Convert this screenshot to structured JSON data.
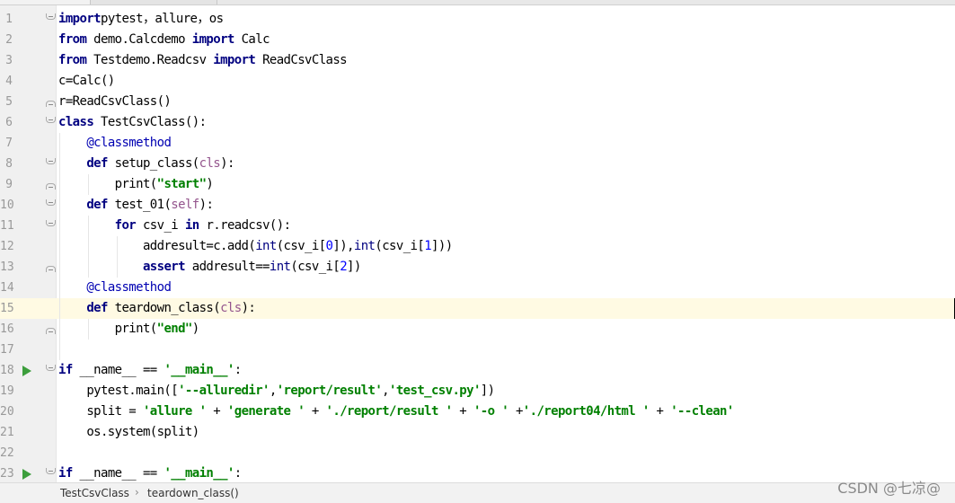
{
  "editor": {
    "current_line": 15,
    "lines": [
      {
        "n": "1",
        "tokens": [
          [
            "kw",
            "import"
          ],
          [
            "",
            "pytest"
          ],
          [
            "",
            "，"
          ],
          [
            "",
            "allure"
          ],
          [
            "",
            "，"
          ],
          [
            "",
            "os"
          ]
        ]
      },
      {
        "n": "2",
        "tokens": [
          [
            "kw",
            "from"
          ],
          [
            "",
            " demo.Calcdemo "
          ],
          [
            "kw",
            "import"
          ],
          [
            "",
            " Calc"
          ]
        ]
      },
      {
        "n": "3",
        "tokens": [
          [
            "kw",
            "from"
          ],
          [
            "",
            " Testdemo.Readcsv "
          ],
          [
            "kw",
            "import"
          ],
          [
            "",
            " ReadCsvClass"
          ]
        ]
      },
      {
        "n": "4",
        "tokens": [
          [
            "",
            "c=Calc()"
          ]
        ]
      },
      {
        "n": "5",
        "tokens": [
          [
            "",
            "r=ReadCsvClass()"
          ]
        ]
      },
      {
        "n": "6",
        "tokens": [
          [
            "kw",
            "class"
          ],
          [
            "",
            " TestCsvClass():"
          ]
        ]
      },
      {
        "n": "7",
        "tokens": [
          [
            "",
            "    "
          ],
          [
            "deco",
            "@classmethod"
          ]
        ]
      },
      {
        "n": "8",
        "tokens": [
          [
            "",
            "    "
          ],
          [
            "kw",
            "def"
          ],
          [
            "",
            " setup_class("
          ],
          [
            "self",
            "cls"
          ],
          [
            "",
            "):"
          ]
        ]
      },
      {
        "n": "9",
        "tokens": [
          [
            "",
            "        print("
          ],
          [
            "str",
            "\"start\""
          ],
          [
            "",
            ")"
          ]
        ]
      },
      {
        "n": "10",
        "tokens": [
          [
            "",
            "    "
          ],
          [
            "kw",
            "def"
          ],
          [
            "",
            " test_01("
          ],
          [
            "self",
            "self"
          ],
          [
            "",
            "):"
          ]
        ]
      },
      {
        "n": "11",
        "tokens": [
          [
            "",
            "        "
          ],
          [
            "kw",
            "for"
          ],
          [
            "",
            " csv_i "
          ],
          [
            "kw",
            "in"
          ],
          [
            "",
            " r.readcsv():"
          ]
        ]
      },
      {
        "n": "12",
        "tokens": [
          [
            "",
            "            addresult=c.add("
          ],
          [
            "builtin",
            "int"
          ],
          [
            "",
            "(csv_i["
          ],
          [
            "num",
            "0"
          ],
          [
            "",
            "]),"
          ],
          [
            "builtin",
            "int"
          ],
          [
            "",
            "(csv_i["
          ],
          [
            "num",
            "1"
          ],
          [
            "",
            "]))"
          ]
        ]
      },
      {
        "n": "13",
        "tokens": [
          [
            "",
            "            "
          ],
          [
            "kw",
            "assert"
          ],
          [
            "",
            " addresult=="
          ],
          [
            "builtin",
            "int"
          ],
          [
            "",
            "(csv_i["
          ],
          [
            "num",
            "2"
          ],
          [
            "",
            "])"
          ]
        ]
      },
      {
        "n": "14",
        "tokens": [
          [
            "",
            "    "
          ],
          [
            "deco",
            "@classmethod"
          ]
        ]
      },
      {
        "n": "15",
        "tokens": [
          [
            "",
            "    "
          ],
          [
            "kw",
            "def"
          ],
          [
            "",
            " teardown_class("
          ],
          [
            "self",
            "cls"
          ],
          [
            "",
            "):"
          ]
        ]
      },
      {
        "n": "16",
        "tokens": [
          [
            "",
            "        print("
          ],
          [
            "str",
            "\"end\""
          ],
          [
            "",
            ")"
          ]
        ]
      },
      {
        "n": "17",
        "tokens": []
      },
      {
        "n": "18",
        "tokens": [
          [
            "kw",
            "if"
          ],
          [
            "",
            " __name__ == "
          ],
          [
            "str",
            "'__main__'"
          ],
          [
            "",
            ":"
          ]
        ]
      },
      {
        "n": "19",
        "tokens": [
          [
            "",
            "    pytest.main(["
          ],
          [
            "str",
            "'--alluredir'"
          ],
          [
            "",
            ","
          ],
          [
            "str",
            "'report/result'"
          ],
          [
            "",
            ","
          ],
          [
            "str",
            "'test_csv.py'"
          ],
          [
            "",
            "])"
          ]
        ]
      },
      {
        "n": "20",
        "tokens": [
          [
            "",
            "    split = "
          ],
          [
            "str",
            "'allure '"
          ],
          [
            "",
            " + "
          ],
          [
            "str",
            "'generate '"
          ],
          [
            "",
            " + "
          ],
          [
            "str",
            "'./report/result '"
          ],
          [
            "",
            " + "
          ],
          [
            "str",
            "'-o '"
          ],
          [
            "",
            " +"
          ],
          [
            "str",
            "'./report04/html '"
          ],
          [
            "",
            " + "
          ],
          [
            "str",
            "'--clean'"
          ]
        ]
      },
      {
        "n": "21",
        "tokens": [
          [
            "",
            "    os.system(split)"
          ]
        ]
      },
      {
        "n": "22",
        "tokens": []
      },
      {
        "n": "23",
        "tokens": [
          [
            "kw",
            "if"
          ],
          [
            "",
            " __name__ == "
          ],
          [
            "str",
            "'__main__'"
          ],
          [
            "",
            ":"
          ]
        ]
      }
    ]
  },
  "gutter": {
    "run_lines": [
      "18",
      "23"
    ],
    "fold_open": [
      "1",
      "6",
      "8",
      "10",
      "11",
      "18",
      "23"
    ],
    "fold_end": [
      "5",
      "9",
      "13",
      "16"
    ]
  },
  "statusbar": {
    "crumb_class": "TestCsvClass",
    "crumb_sep": "›",
    "crumb_method": "teardown_class()"
  },
  "watermark": "CSDN @七凉@"
}
